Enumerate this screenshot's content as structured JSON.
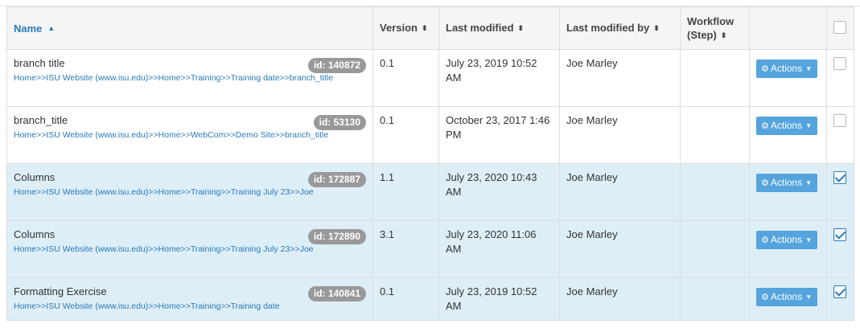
{
  "header": {
    "name": "Name",
    "version": "Version",
    "last_modified": "Last modified",
    "last_modified_by": "Last modified by",
    "workflow_line1": "Workflow",
    "workflow_line2": "(Step)",
    "actions": ""
  },
  "rows": [
    {
      "title": "branch title",
      "id": "id: 140872",
      "path": "Home>>ISU Website (www.isu.edu)>>Home>>Training>>Training date>>branch_title",
      "version": "0.1",
      "modified": "July 23, 2019 10:52 AM",
      "modified_by": "Joe Marley",
      "workflow": "",
      "action_label": "Actions",
      "checked": false
    },
    {
      "title": "branch_title",
      "id": "id: 53130",
      "path": "Home>>ISU Website (www.isu.edu)>>Home>>WebCom>>Demo Site>>branch_title",
      "version": "0.1",
      "modified": "October 23, 2017 1:46 PM",
      "modified_by": "Joe Marley",
      "workflow": "",
      "action_label": "Actions",
      "checked": false
    },
    {
      "title": "Columns",
      "id": "id: 172887",
      "path": "Home>>ISU Website (www.isu.edu)>>Home>>Training>>Training July 23>>Joe",
      "version": "1.1",
      "modified": "July 23, 2020 10:43 AM",
      "modified_by": "Joe Marley",
      "workflow": "",
      "action_label": "Actions",
      "checked": true
    },
    {
      "title": "Columns",
      "id": "id: 172890",
      "path": "Home>>ISU Website (www.isu.edu)>>Home>>Training>>Training July 23>>Joe",
      "version": "3.1",
      "modified": "July 23, 2020 11:06 AM",
      "modified_by": "Joe Marley",
      "workflow": "",
      "action_label": "Actions",
      "checked": true
    },
    {
      "title": "Formatting Exercise",
      "id": "id: 140841",
      "path": "Home>>ISU Website (www.isu.edu)>>Home>>Training>>Training date",
      "version": "0.1",
      "modified": "July 23, 2019 10:52 AM",
      "modified_by": "Joe Marley",
      "workflow": "",
      "action_label": "Actions",
      "checked": true
    }
  ],
  "icons": {
    "sort_asc": "▲",
    "sort_both": "⬍",
    "cog": "⚙",
    "caret": "▼"
  },
  "colors": {
    "link_blue": "#2a7ab8",
    "action_button": "#55a4dd",
    "selected_row": "#ddeef7",
    "id_badge": "#999999"
  }
}
